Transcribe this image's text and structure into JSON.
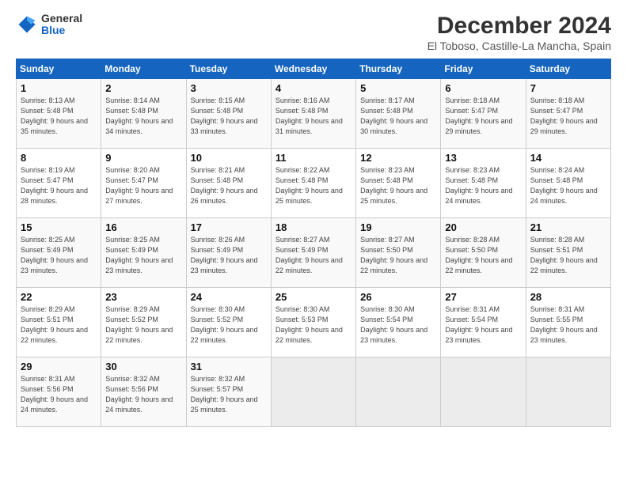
{
  "header": {
    "logo_general": "General",
    "logo_blue": "Blue",
    "title": "December 2024",
    "subtitle": "El Toboso, Castille-La Mancha, Spain"
  },
  "days_of_week": [
    "Sunday",
    "Monday",
    "Tuesday",
    "Wednesday",
    "Thursday",
    "Friday",
    "Saturday"
  ],
  "weeks": [
    [
      {
        "day": "1",
        "info": "Sunrise: 8:13 AM\nSunset: 5:48 PM\nDaylight: 9 hours and 35 minutes."
      },
      {
        "day": "2",
        "info": "Sunrise: 8:14 AM\nSunset: 5:48 PM\nDaylight: 9 hours and 34 minutes."
      },
      {
        "day": "3",
        "info": "Sunrise: 8:15 AM\nSunset: 5:48 PM\nDaylight: 9 hours and 33 minutes."
      },
      {
        "day": "4",
        "info": "Sunrise: 8:16 AM\nSunset: 5:48 PM\nDaylight: 9 hours and 31 minutes."
      },
      {
        "day": "5",
        "info": "Sunrise: 8:17 AM\nSunset: 5:48 PM\nDaylight: 9 hours and 30 minutes."
      },
      {
        "day": "6",
        "info": "Sunrise: 8:18 AM\nSunset: 5:47 PM\nDaylight: 9 hours and 29 minutes."
      },
      {
        "day": "7",
        "info": "Sunrise: 8:18 AM\nSunset: 5:47 PM\nDaylight: 9 hours and 29 minutes."
      }
    ],
    [
      {
        "day": "8",
        "info": "Sunrise: 8:19 AM\nSunset: 5:47 PM\nDaylight: 9 hours and 28 minutes."
      },
      {
        "day": "9",
        "info": "Sunrise: 8:20 AM\nSunset: 5:47 PM\nDaylight: 9 hours and 27 minutes."
      },
      {
        "day": "10",
        "info": "Sunrise: 8:21 AM\nSunset: 5:48 PM\nDaylight: 9 hours and 26 minutes."
      },
      {
        "day": "11",
        "info": "Sunrise: 8:22 AM\nSunset: 5:48 PM\nDaylight: 9 hours and 25 minutes."
      },
      {
        "day": "12",
        "info": "Sunrise: 8:23 AM\nSunset: 5:48 PM\nDaylight: 9 hours and 25 minutes."
      },
      {
        "day": "13",
        "info": "Sunrise: 8:23 AM\nSunset: 5:48 PM\nDaylight: 9 hours and 24 minutes."
      },
      {
        "day": "14",
        "info": "Sunrise: 8:24 AM\nSunset: 5:48 PM\nDaylight: 9 hours and 24 minutes."
      }
    ],
    [
      {
        "day": "15",
        "info": "Sunrise: 8:25 AM\nSunset: 5:49 PM\nDaylight: 9 hours and 23 minutes."
      },
      {
        "day": "16",
        "info": "Sunrise: 8:25 AM\nSunset: 5:49 PM\nDaylight: 9 hours and 23 minutes."
      },
      {
        "day": "17",
        "info": "Sunrise: 8:26 AM\nSunset: 5:49 PM\nDaylight: 9 hours and 23 minutes."
      },
      {
        "day": "18",
        "info": "Sunrise: 8:27 AM\nSunset: 5:49 PM\nDaylight: 9 hours and 22 minutes."
      },
      {
        "day": "19",
        "info": "Sunrise: 8:27 AM\nSunset: 5:50 PM\nDaylight: 9 hours and 22 minutes."
      },
      {
        "day": "20",
        "info": "Sunrise: 8:28 AM\nSunset: 5:50 PM\nDaylight: 9 hours and 22 minutes."
      },
      {
        "day": "21",
        "info": "Sunrise: 8:28 AM\nSunset: 5:51 PM\nDaylight: 9 hours and 22 minutes."
      }
    ],
    [
      {
        "day": "22",
        "info": "Sunrise: 8:29 AM\nSunset: 5:51 PM\nDaylight: 9 hours and 22 minutes."
      },
      {
        "day": "23",
        "info": "Sunrise: 8:29 AM\nSunset: 5:52 PM\nDaylight: 9 hours and 22 minutes."
      },
      {
        "day": "24",
        "info": "Sunrise: 8:30 AM\nSunset: 5:52 PM\nDaylight: 9 hours and 22 minutes."
      },
      {
        "day": "25",
        "info": "Sunrise: 8:30 AM\nSunset: 5:53 PM\nDaylight: 9 hours and 22 minutes."
      },
      {
        "day": "26",
        "info": "Sunrise: 8:30 AM\nSunset: 5:54 PM\nDaylight: 9 hours and 23 minutes."
      },
      {
        "day": "27",
        "info": "Sunrise: 8:31 AM\nSunset: 5:54 PM\nDaylight: 9 hours and 23 minutes."
      },
      {
        "day": "28",
        "info": "Sunrise: 8:31 AM\nSunset: 5:55 PM\nDaylight: 9 hours and 23 minutes."
      }
    ],
    [
      {
        "day": "29",
        "info": "Sunrise: 8:31 AM\nSunset: 5:56 PM\nDaylight: 9 hours and 24 minutes."
      },
      {
        "day": "30",
        "info": "Sunrise: 8:32 AM\nSunset: 5:56 PM\nDaylight: 9 hours and 24 minutes."
      },
      {
        "day": "31",
        "info": "Sunrise: 8:32 AM\nSunset: 5:57 PM\nDaylight: 9 hours and 25 minutes."
      },
      {
        "day": "",
        "info": ""
      },
      {
        "day": "",
        "info": ""
      },
      {
        "day": "",
        "info": ""
      },
      {
        "day": "",
        "info": ""
      }
    ]
  ]
}
